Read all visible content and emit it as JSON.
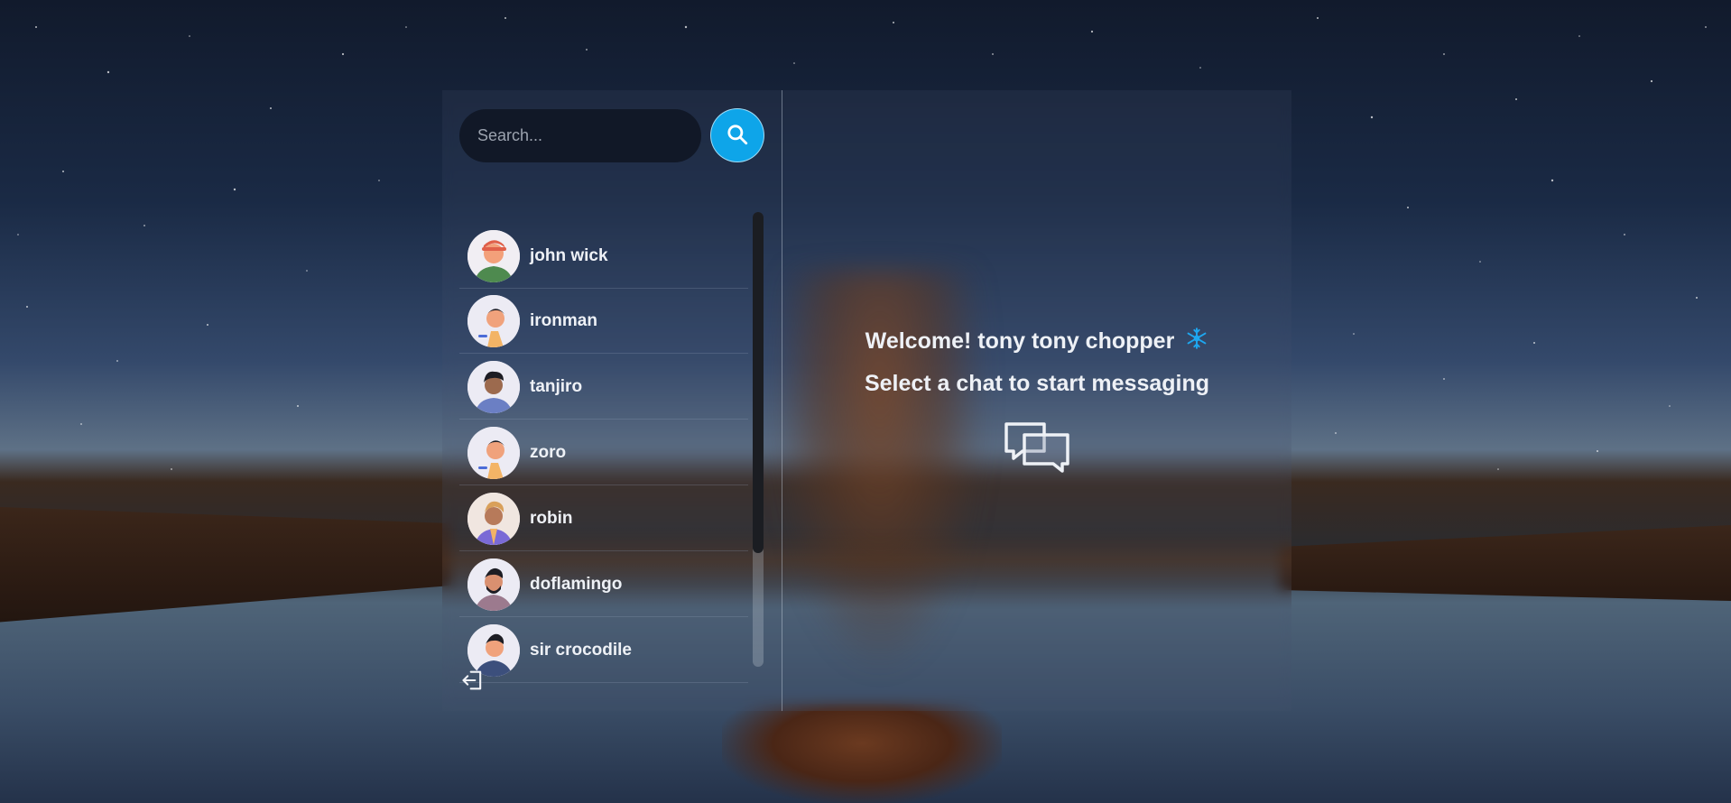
{
  "search": {
    "placeholder": "Search..."
  },
  "conversations": [
    {
      "name": "john wick"
    },
    {
      "name": "ironman"
    },
    {
      "name": "tanjiro"
    },
    {
      "name": "zoro"
    },
    {
      "name": "robin"
    },
    {
      "name": "doflamingo"
    },
    {
      "name": "sir crocodile"
    }
  ],
  "welcome": {
    "greeting": "Welcome! tony tony chopper",
    "greeting_icon": "snowflake-icon",
    "subtitle": "Select a chat to start messaging",
    "icon": "chat-bubbles-icon"
  },
  "colors": {
    "accent": "#0ea5e9",
    "input_bg": "#111827",
    "text": "#eef1f6"
  }
}
